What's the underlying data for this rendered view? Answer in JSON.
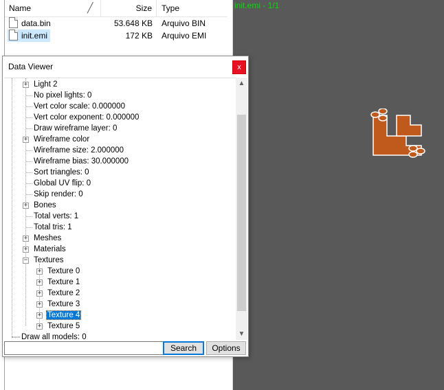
{
  "file_list": {
    "columns": {
      "name": "Name",
      "size": "Size",
      "type": "Type"
    },
    "files": [
      {
        "name": "data.bin",
        "size": "53.648 KB",
        "type": "Arquivo BIN"
      },
      {
        "name": "init.emi",
        "size": "172 KB",
        "type": "Arquivo EMI"
      }
    ]
  },
  "viewer": {
    "title": "init.emi - 1/1",
    "accent_color": "#c05a1c"
  },
  "dialog": {
    "title": "Data Viewer",
    "close_glyph": "x",
    "tree": {
      "light2": "Light 2",
      "no_pixel_lights": "No pixel lights: 0",
      "vert_color_scale": "Vert color scale: 0.000000",
      "vert_color_exponent": "Vert color exponent: 0.000000",
      "draw_wireframe_layer": "Draw wireframe layer: 0",
      "wireframe_color": "Wireframe color",
      "wireframe_size": "Wireframe size: 2.000000",
      "wireframe_bias": "Wireframe bias: 30.000000",
      "sort_triangles": "Sort triangles: 0",
      "global_uv_flip": "Global UV flip: 0",
      "skip_render": "Skip render: 0",
      "bones": "Bones",
      "total_verts": "Total verts: 1",
      "total_tris": "Total tris: 1",
      "meshes": "Meshes",
      "materials": "Materials",
      "textures": "Textures",
      "texture0": "Texture 0",
      "texture1": "Texture 1",
      "texture2": "Texture 2",
      "texture3": "Texture 3",
      "texture4": "Texture 4",
      "texture5": "Texture 5",
      "draw_all_models": "Draw all models: 0"
    },
    "search_value": "",
    "search_button": "Search",
    "options_button": "Options"
  }
}
